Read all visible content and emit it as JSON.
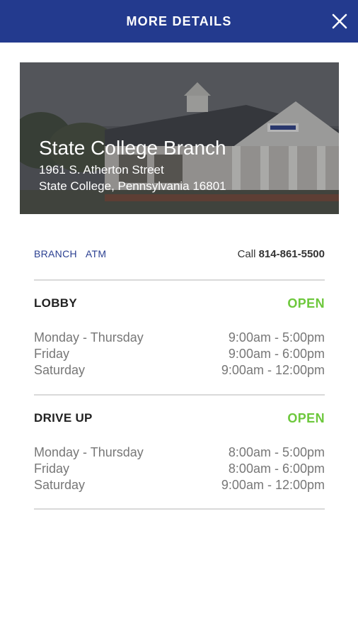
{
  "header": {
    "title": "MORE DETAILS"
  },
  "branch": {
    "name": "State College Branch",
    "address_line1": "1961 S. Atherton Street",
    "address_line2": "State College, Pennsylvania 16801"
  },
  "links": {
    "branch": "BRANCH",
    "atm": "ATM",
    "call_label": "Call",
    "phone": "814-861-5500"
  },
  "sections": [
    {
      "title": "LOBBY",
      "status": "OPEN",
      "hours": [
        {
          "day": "Monday - Thursday",
          "time": "9:00am - 5:00pm"
        },
        {
          "day": "Friday",
          "time": "9:00am - 6:00pm"
        },
        {
          "day": "Saturday",
          "time": "9:00am - 12:00pm"
        }
      ]
    },
    {
      "title": "DRIVE UP",
      "status": "OPEN",
      "hours": [
        {
          "day": "Monday - Thursday",
          "time": "8:00am - 5:00pm"
        },
        {
          "day": "Friday",
          "time": "8:00am - 6:00pm"
        },
        {
          "day": "Saturday",
          "time": "9:00am - 12:00pm"
        }
      ]
    }
  ],
  "colors": {
    "header": "#233a8e",
    "link": "#2a3f91",
    "open": "#6dc83c"
  },
  "icons": {
    "close": "close-icon"
  }
}
